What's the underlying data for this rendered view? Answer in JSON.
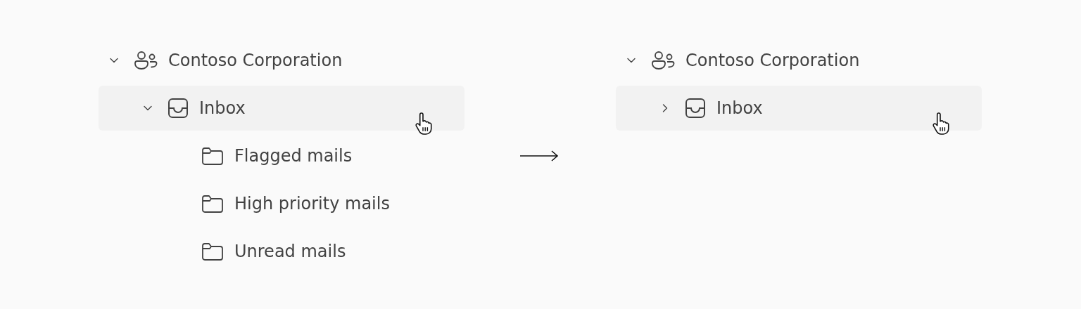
{
  "panels": [
    {
      "tree": [
        {
          "label": "Contoso Corporation",
          "kind": "group",
          "expanded": true,
          "hovered": false,
          "children": [
            {
              "label": "Inbox",
              "kind": "inbox",
              "expanded": true,
              "hovered": true,
              "children": [
                {
                  "label": "Flagged mails",
                  "kind": "folder",
                  "hovered": false
                },
                {
                  "label": "High priority mails",
                  "kind": "folder",
                  "hovered": false
                },
                {
                  "label": "Unread mails",
                  "kind": "folder",
                  "hovered": false
                }
              ]
            }
          ]
        }
      ]
    },
    {
      "tree": [
        {
          "label": "Contoso Corporation",
          "kind": "group",
          "expanded": true,
          "hovered": false,
          "children": [
            {
              "label": "Inbox",
              "kind": "inbox",
              "expanded": false,
              "hovered": true
            }
          ]
        }
      ]
    }
  ]
}
